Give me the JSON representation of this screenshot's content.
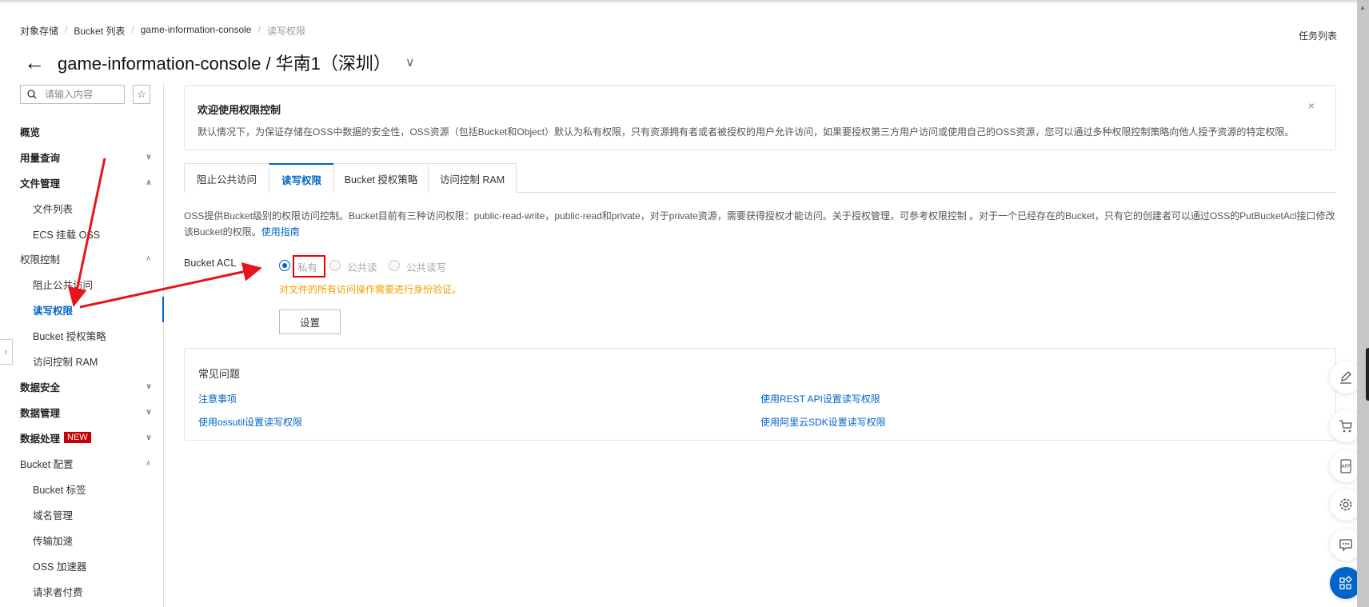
{
  "breadcrumb": [
    "对象存储",
    "Bucket 列表",
    "game-information-console",
    "读写权限"
  ],
  "header": {
    "title": "game-information-console / 华南1（深圳）",
    "task_list": "任务列表"
  },
  "sidebar": {
    "search_placeholder": "请输入内容",
    "items": [
      {
        "label": "概览",
        "level": 1,
        "chevron": ""
      },
      {
        "label": "用量查询",
        "level": 1,
        "chevron": "down"
      },
      {
        "label": "文件管理",
        "level": 1,
        "chevron": "up"
      },
      {
        "label": "文件列表",
        "level": 2
      },
      {
        "label": "ECS 挂载 OSS",
        "level": 2
      },
      {
        "label": "权限控制",
        "level": 1,
        "chevron": "up",
        "regular": true
      },
      {
        "label": "阻止公共访问",
        "level": 2
      },
      {
        "label": "读写权限",
        "level": 2,
        "active": true
      },
      {
        "label": "Bucket 授权策略",
        "level": 2
      },
      {
        "label": "访问控制 RAM",
        "level": 2
      },
      {
        "label": "数据安全",
        "level": 1,
        "chevron": "down"
      },
      {
        "label": "数据管理",
        "level": 1,
        "chevron": "down"
      },
      {
        "label": "数据处理",
        "level": 1,
        "chevron": "down",
        "badge": "NEW"
      },
      {
        "label": "Bucket 配置",
        "level": 1,
        "chevron": "up",
        "regular": true
      },
      {
        "label": "Bucket 标签",
        "level": 2
      },
      {
        "label": "域名管理",
        "level": 2
      },
      {
        "label": "传输加速",
        "level": 2
      },
      {
        "label": "OSS 加速器",
        "level": 2
      },
      {
        "label": "请求者付费",
        "level": 2
      }
    ]
  },
  "welcome": {
    "title": "欢迎使用权限控制",
    "text": "默认情况下，为保证存储在OSS中数据的安全性，OSS资源（包括Bucket和Object）默认为私有权限，只有资源拥有者或者被授权的用户允许访问，如果要授权第三方用户访问或使用自己的OSS资源，您可以通过多种权限控制策略向他人授予资源的特定权限。",
    "close": "×"
  },
  "tabs": [
    {
      "label": "阻止公共访问"
    },
    {
      "label": "读写权限",
      "active": true
    },
    {
      "label": "Bucket 授权策略"
    },
    {
      "label": "访问控制 RAM"
    }
  ],
  "description": {
    "text": "OSS提供Bucket级别的权限访问控制。Bucket目前有三种访问权限：public-read-write，public-read和private，对于private资源，需要获得授权才能访问。关于授权管理，可参考权限控制 。对于一个已经存在的Bucket，只有它的创建者可以通过OSS的PutBucketAcl接口修改该Bucket的权限。",
    "link": "使用指南"
  },
  "acl": {
    "label": "Bucket ACL",
    "options": [
      {
        "label": "私有",
        "checked": true
      },
      {
        "label": "公共读",
        "checked": false
      },
      {
        "label": "公共读写",
        "checked": false
      }
    ],
    "hint": "对文件的所有访问操作需要进行身份验证。",
    "button": "设置"
  },
  "faq": {
    "title": "常见问题",
    "links": [
      "注意事项",
      "使用REST API设置读写权限",
      "使用ossutil设置读写权限",
      "使用阿里云SDK设置读写权限"
    ]
  },
  "floating_tools": [
    "edit-icon",
    "cart-icon",
    "app-icon",
    "gear-icon",
    "chat-icon",
    "apps-icon"
  ],
  "colors": {
    "accent": "#0064c8",
    "hint": "#f0a000",
    "badge": "#c80000",
    "annotation": "#e8141c"
  }
}
